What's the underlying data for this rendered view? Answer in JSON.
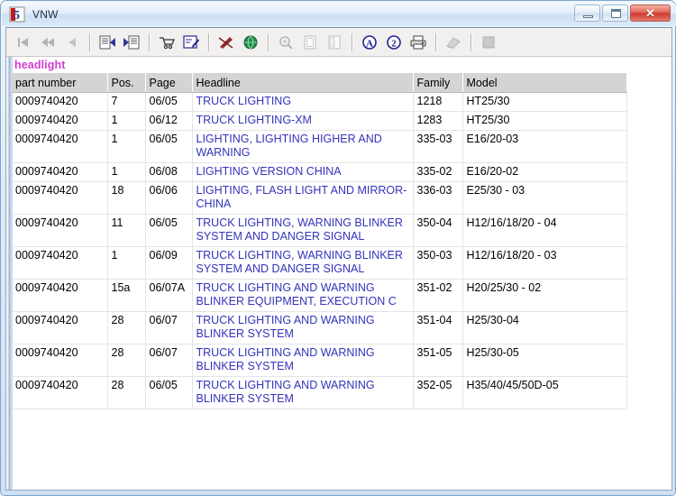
{
  "window": {
    "title": "VNW",
    "icon": "app-icon",
    "controls": {
      "minimize": "minimize",
      "maximize": "maximize",
      "close": "✕"
    }
  },
  "toolbar": {
    "buttons": [
      {
        "name": "first-record-icon",
        "icon": "skip-back",
        "enabled": false
      },
      {
        "name": "fast-rewind-icon",
        "icon": "rewind",
        "enabled": false
      },
      {
        "name": "previous-record-icon",
        "icon": "prev",
        "enabled": false
      },
      {
        "name": "separator",
        "icon": "sep",
        "enabled": false
      },
      {
        "name": "document-prev-icon",
        "icon": "doc-left",
        "enabled": true
      },
      {
        "name": "document-next-icon",
        "icon": "doc-right",
        "enabled": true
      },
      {
        "name": "separator",
        "icon": "sep",
        "enabled": false
      },
      {
        "name": "shopping-cart-icon",
        "icon": "cart",
        "enabled": true
      },
      {
        "name": "edit-form-icon",
        "icon": "form-pencil",
        "enabled": true
      },
      {
        "name": "separator",
        "icon": "sep",
        "enabled": false
      },
      {
        "name": "pen-annotate-icon",
        "icon": "pen",
        "enabled": true
      },
      {
        "name": "globe-icon",
        "icon": "globe",
        "enabled": true
      },
      {
        "name": "separator",
        "icon": "sep",
        "enabled": false
      },
      {
        "name": "zoom-icon",
        "icon": "magnifier",
        "enabled": false
      },
      {
        "name": "page-single-icon",
        "icon": "page1",
        "enabled": false
      },
      {
        "name": "page-double-icon",
        "icon": "page2",
        "enabled": false
      },
      {
        "name": "separator",
        "icon": "sep",
        "enabled": false
      },
      {
        "name": "letter-a-icon",
        "icon": "circle-a",
        "enabled": true
      },
      {
        "name": "number-two-icon",
        "icon": "circle-2",
        "enabled": true
      },
      {
        "name": "print-icon",
        "icon": "printer",
        "enabled": true
      },
      {
        "name": "separator",
        "icon": "sep",
        "enabled": false
      },
      {
        "name": "book-icon",
        "icon": "book",
        "enabled": false
      },
      {
        "name": "separator",
        "icon": "sep",
        "enabled": false
      },
      {
        "name": "stop-icon",
        "icon": "square",
        "enabled": false
      }
    ]
  },
  "search": {
    "term": "headlight",
    "term_color": "#d23bd2"
  },
  "table": {
    "columns": [
      "part number",
      "Pos.",
      "Page",
      "Headline",
      "Family",
      "Model"
    ],
    "link_color": "#3333bb",
    "rows": [
      {
        "part": "0009740420",
        "pos": "7",
        "page": "06/05",
        "headline": "TRUCK LIGHTING",
        "family": "1218",
        "model": "HT25/30"
      },
      {
        "part": "0009740420",
        "pos": "1",
        "page": "06/12",
        "headline": "TRUCK LIGHTING-XM",
        "family": "1283",
        "model": "HT25/30"
      },
      {
        "part": "0009740420",
        "pos": "1",
        "page": "06/05",
        "headline": "LIGHTING, LIGHTING HIGHER AND WARNING",
        "family": "335-03",
        "model": "E16/20-03"
      },
      {
        "part": "0009740420",
        "pos": "1",
        "page": "06/08",
        "headline": "LIGHTING VERSION CHINA",
        "family": "335-02",
        "model": "E16/20-02"
      },
      {
        "part": "0009740420",
        "pos": "18",
        "page": "06/06",
        "headline": "LIGHTING, FLASH LIGHT AND MIRROR-CHINA",
        "family": "336-03",
        "model": "E25/30 - 03"
      },
      {
        "part": "0009740420",
        "pos": "11",
        "page": "06/05",
        "headline": "TRUCK LIGHTING, WARNING BLINKER SYSTEM AND DANGER SIGNAL",
        "family": "350-04",
        "model": "H12/16/18/20 - 04"
      },
      {
        "part": "0009740420",
        "pos": "1",
        "page": "06/09",
        "headline": "TRUCK LIGHTING, WARNING BLINKER SYSTEM AND DANGER SIGNAL",
        "family": "350-03",
        "model": "H12/16/18/20 - 03"
      },
      {
        "part": "0009740420",
        "pos": "15a",
        "page": "06/07A",
        "headline": "TRUCK LIGHTING AND WARNING BLINKER EQUIPMENT, EXECUTION C",
        "family": "351-02",
        "model": "H20/25/30 - 02"
      },
      {
        "part": "0009740420",
        "pos": "28",
        "page": "06/07",
        "headline": "TRUCK LIGHTING AND WARNING BLINKER SYSTEM",
        "family": "351-04",
        "model": "H25/30-04"
      },
      {
        "part": "0009740420",
        "pos": "28",
        "page": "06/07",
        "headline": "TRUCK LIGHTING AND WARNING BLINKER SYSTEM",
        "family": "351-05",
        "model": "H25/30-05"
      },
      {
        "part": "0009740420",
        "pos": "28",
        "page": "06/05",
        "headline": "TRUCK LIGHTING AND WARNING BLINKER SYSTEM",
        "family": "352-05",
        "model": "H35/40/45/50D-05"
      }
    ]
  }
}
